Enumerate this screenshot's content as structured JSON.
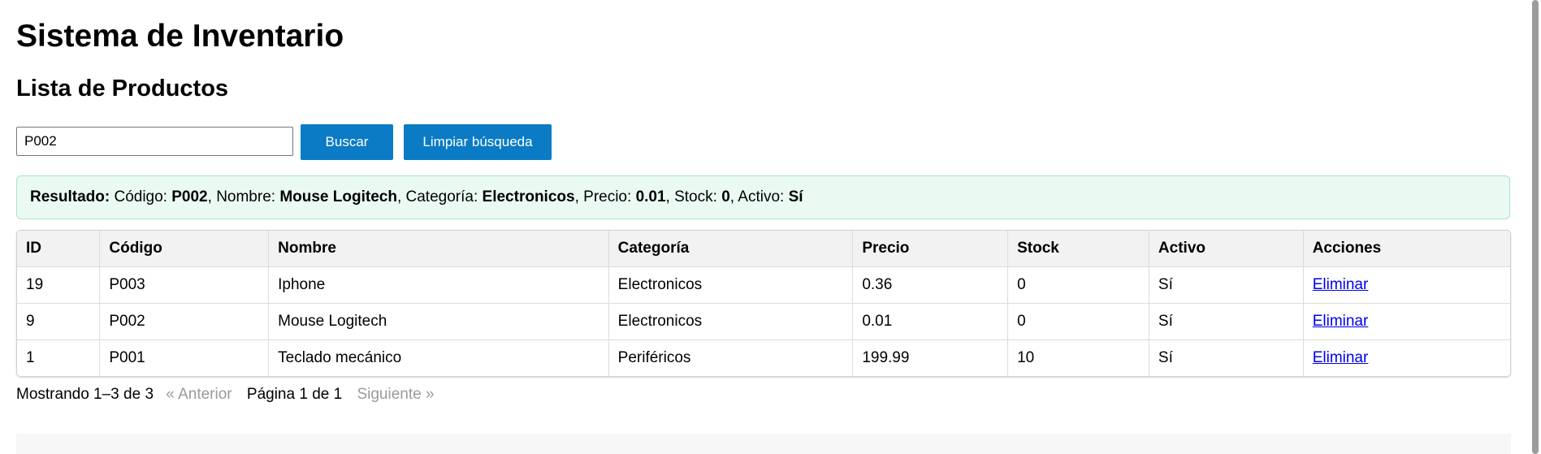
{
  "app": {
    "title": "Sistema de Inventario",
    "section_title": "Lista de Productos"
  },
  "search": {
    "value": "P002",
    "search_button": "Buscar",
    "clear_button": "Limpiar búsqueda"
  },
  "result": {
    "label": "Resultado:",
    "codigo_label": "Código:",
    "codigo": "P002",
    "nombre_label": "Nombre:",
    "nombre": "Mouse Logitech",
    "categoria_label": "Categoría:",
    "categoria": "Electronicos",
    "precio_label": "Precio:",
    "precio": "0.01",
    "stock_label": "Stock:",
    "stock": "0",
    "activo_label": "Activo:",
    "activo": "Sí"
  },
  "table": {
    "headers": [
      "ID",
      "Código",
      "Nombre",
      "Categoría",
      "Precio",
      "Stock",
      "Activo",
      "Acciones"
    ],
    "rows": [
      [
        "19",
        "P003",
        "Iphone",
        "Electronicos",
        "0.36",
        "0",
        "Sí",
        "Eliminar"
      ],
      [
        "9",
        "P002",
        "Mouse Logitech",
        "Electronicos",
        "0.01",
        "0",
        "Sí",
        "Eliminar"
      ],
      [
        "1",
        "P001",
        "Teclado mecánico",
        "Periféricos",
        "199.99",
        "10",
        "Sí",
        "Eliminar"
      ]
    ]
  },
  "pagination": {
    "showing": "Mostrando 1–3 de 3",
    "prev": "« Anterior",
    "page_info": "Página 1 de 1",
    "next": "Siguiente »"
  },
  "colors": {
    "button_bg": "#0a7bc4",
    "result_bg": "#eafaf3",
    "result_border": "#a7e3c6",
    "link": "#0000ee",
    "disabled": "#9a9a9a"
  }
}
